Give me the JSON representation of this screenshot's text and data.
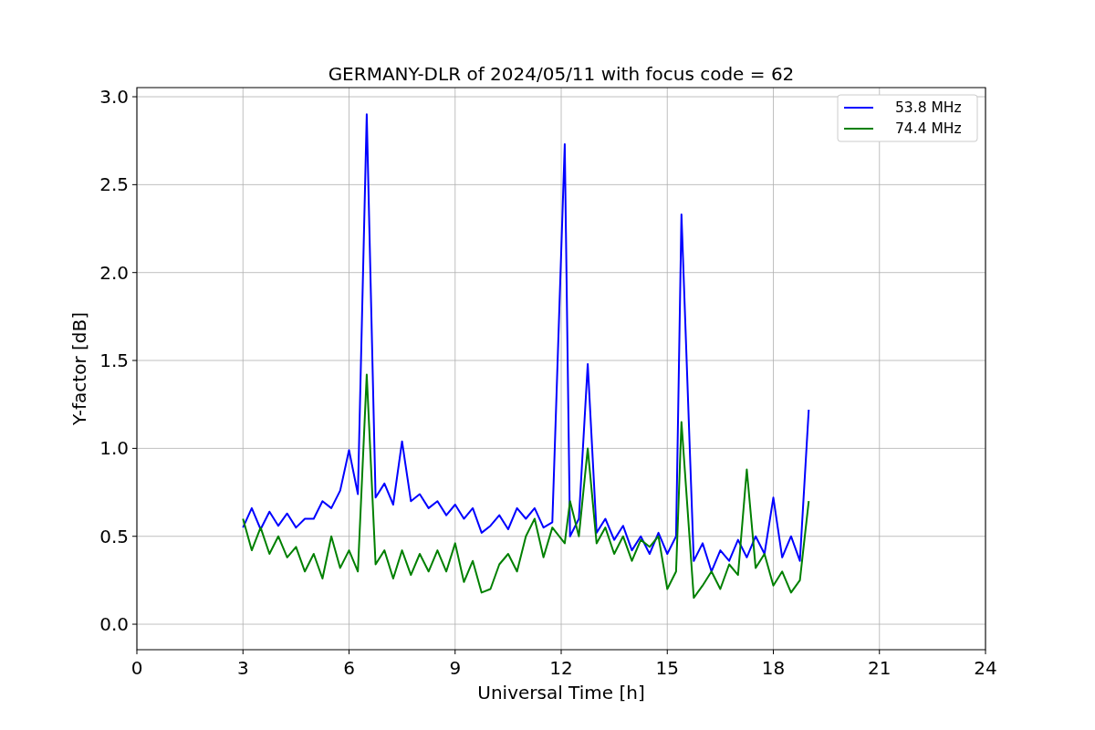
{
  "figure": {
    "chart_data": {
      "type": "line",
      "title": "GERMANY-DLR of 2024/05/11 with focus code = 62",
      "xlabel": "Universal Time [h]",
      "ylabel": "Y-factor [dB]",
      "x": [
        3.0,
        3.25,
        3.5,
        3.75,
        4.0,
        4.25,
        4.5,
        4.75,
        5.0,
        5.25,
        5.5,
        5.75,
        6.0,
        6.25,
        6.5,
        6.75,
        7.0,
        7.25,
        7.5,
        7.75,
        8.0,
        8.25,
        8.5,
        8.75,
        9.0,
        9.25,
        9.5,
        9.75,
        10.0,
        10.25,
        10.5,
        10.75,
        11.0,
        11.25,
        11.5,
        11.75,
        12.1,
        12.25,
        12.5,
        12.75,
        13.0,
        13.25,
        13.5,
        13.75,
        14.0,
        14.25,
        14.5,
        14.75,
        15.0,
        15.25,
        15.4,
        15.75,
        16.0,
        16.25,
        16.5,
        16.75,
        17.0,
        17.25,
        17.5,
        17.75,
        18.0,
        18.25,
        18.5,
        18.75,
        19.0
      ],
      "series": [
        {
          "name": "53.8 MHz",
          "color": "#0000ff",
          "values": [
            0.55,
            0.66,
            0.54,
            0.64,
            0.56,
            0.63,
            0.55,
            0.6,
            0.6,
            0.7,
            0.66,
            0.76,
            0.99,
            0.74,
            2.9,
            0.72,
            0.8,
            0.68,
            1.04,
            0.7,
            0.74,
            0.66,
            0.7,
            0.62,
            0.68,
            0.6,
            0.66,
            0.52,
            0.56,
            0.62,
            0.54,
            0.66,
            0.6,
            0.66,
            0.55,
            0.58,
            2.73,
            0.5,
            0.6,
            1.48,
            0.52,
            0.6,
            0.48,
            0.56,
            0.42,
            0.5,
            0.4,
            0.52,
            0.4,
            0.5,
            2.33,
            0.36,
            0.46,
            0.3,
            0.42,
            0.36,
            0.48,
            0.38,
            0.5,
            0.4,
            0.72,
            0.38,
            0.5,
            0.36,
            1.22
          ]
        },
        {
          "name": "74.4 MHz",
          "color": "#008000",
          "values": [
            0.6,
            0.42,
            0.55,
            0.4,
            0.5,
            0.38,
            0.44,
            0.3,
            0.4,
            0.26,
            0.5,
            0.32,
            0.42,
            0.3,
            1.42,
            0.34,
            0.42,
            0.26,
            0.42,
            0.28,
            0.4,
            0.3,
            0.42,
            0.3,
            0.46,
            0.24,
            0.36,
            0.18,
            0.2,
            0.34,
            0.4,
            0.3,
            0.5,
            0.6,
            0.38,
            0.55,
            0.46,
            0.7,
            0.5,
            1.0,
            0.46,
            0.55,
            0.4,
            0.5,
            0.36,
            0.48,
            0.44,
            0.5,
            0.2,
            0.3,
            1.15,
            0.15,
            0.22,
            0.3,
            0.2,
            0.34,
            0.28,
            0.88,
            0.32,
            0.4,
            0.22,
            0.3,
            0.18,
            0.25,
            0.7
          ]
        }
      ],
      "grid": true,
      "legend": true,
      "xlim": [
        0,
        24
      ],
      "ylim": [
        -0.145,
        3.052
      ],
      "xticks": [
        0,
        3,
        6,
        9,
        12,
        15,
        18,
        21,
        24
      ],
      "yticks": [
        {
          "value": 0,
          "label": "0.0"
        },
        {
          "value": 0.5,
          "label": "0.5"
        },
        {
          "value": 1,
          "label": "1.0"
        },
        {
          "value": 1.5,
          "label": "1.5"
        },
        {
          "value": 2,
          "label": "2.0"
        },
        {
          "value": 2.5,
          "label": "2.5"
        },
        {
          "value": 3,
          "label": "3.0"
        }
      ]
    }
  }
}
